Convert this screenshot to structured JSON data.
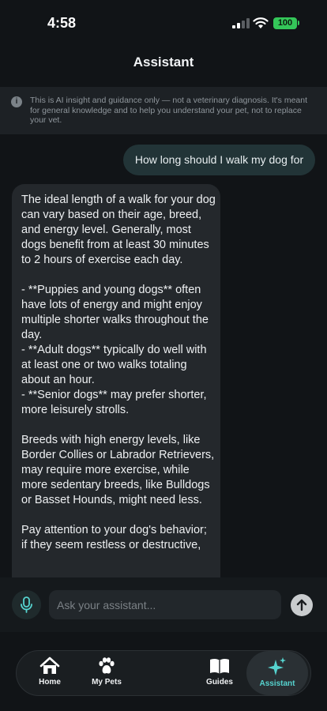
{
  "status_bar": {
    "time": "4:58",
    "battery": "100"
  },
  "header": {
    "title": "Assistant"
  },
  "disclaimer": {
    "icon": "info-icon",
    "text": "This is AI insight and guidance only — not a veterinary diagnosis. It's meant for general knowledge and to help you understand your pet, not to replace your vet."
  },
  "chat": {
    "user_message": "How long should I walk my dog for",
    "assistant_paragraphs": [
      "The ideal length of a walk for your dog can vary based on their age, breed, and energy level. Generally, most dogs benefit from at least 30 minutes to 2 hours of exercise each day.",
      "- **Puppies and young dogs** often have lots of energy and might enjoy multiple shorter walks throughout the day.",
      "- **Adult dogs** typically do well with at least one or two walks totaling about an hour.",
      "- **Senior dogs** may prefer shorter, more leisurely strolls.",
      "Breeds with high energy levels, like Border Collies or Labrador Retrievers, may require more exercise, while more sedentary breeds, like Bulldogs or Basset Hounds, might need less.",
      "Pay attention to your dog's behavior; if they seem restless or destructive,"
    ]
  },
  "composer": {
    "placeholder": "Ask your assistant...",
    "value": ""
  },
  "tabs": [
    {
      "label": "Home",
      "icon": "home-icon"
    },
    {
      "label": "My Pets",
      "icon": "paw-icon"
    },
    {
      "label": "Guides",
      "icon": "book-icon"
    },
    {
      "label": "Assistant",
      "icon": "sparkles-icon",
      "active": true
    }
  ],
  "colors": {
    "accent": "#56d3cf",
    "battery": "#34c759",
    "background": "#111417"
  }
}
